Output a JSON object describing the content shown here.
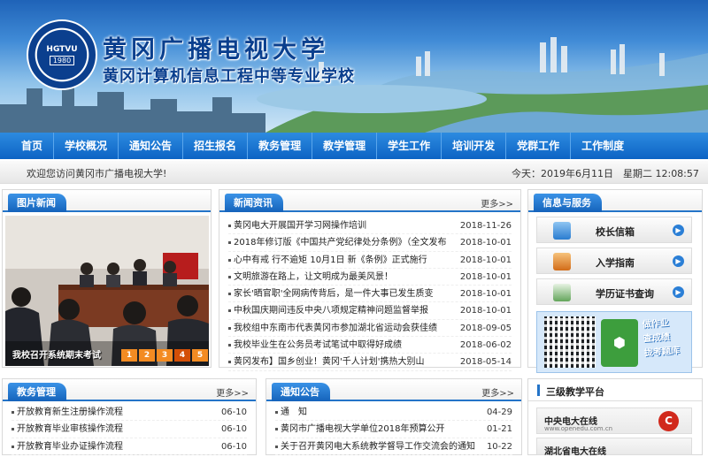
{
  "site": {
    "logo_text": "HGTVU",
    "logo_year": "1980",
    "title": "黄冈广播电视大学",
    "subtitle": "黄冈计算机信息工程中等专业学校"
  },
  "nav": [
    "首页",
    "学校概况",
    "通知公告",
    "招生报名",
    "教务管理",
    "教学管理",
    "学生工作",
    "培训开发",
    "党群工作",
    "工作制度"
  ],
  "welcome": {
    "text": "欢迎您访问黄冈市广播电视大学!",
    "date": "今天：2019年6月11日　星期二 12:08:57"
  },
  "photo_news": {
    "title": "图片新闻",
    "caption": "我校召开系统期末考试",
    "pages": [
      "1",
      "2",
      "3",
      "4",
      "5"
    ],
    "active_page": "4"
  },
  "news": {
    "title": "新闻资讯",
    "more": "更多>>",
    "items": [
      {
        "title": "黄冈电大开展国开学习网操作培训",
        "date": "2018-11-26"
      },
      {
        "title": "2018年修订版《中国共产党纪律处分条例》（全文发布",
        "date": "2018-10-01"
      },
      {
        "title": "心中有戒 行不逾矩 10月1日 新《条例》正式施行",
        "date": "2018-10-01"
      },
      {
        "title": "文明旅游在路上，让文明成为最美风景！",
        "date": "2018-10-01"
      },
      {
        "title": "家长'晒官职'全网病传背后，是一件大事已发生质变",
        "date": "2018-10-01"
      },
      {
        "title": "中秋国庆期间违反中央八项规定精神问题监督举报",
        "date": "2018-10-01"
      },
      {
        "title": "我校组中东南市代表黄冈市参加湖北省运动会获佳绩",
        "date": "2018-09-05"
      },
      {
        "title": "我校毕业生在公务员考试笔试中取得好成绩",
        "date": "2018-06-02"
      },
      {
        "title": "黄冈发布】国乡创业！黄冈'千人计划'携热大别山",
        "date": "2018-05-14"
      }
    ]
  },
  "services": {
    "title": "信息与服务",
    "items": [
      "校长信箱",
      "入学指南",
      "学历证书查询"
    ],
    "qr_text": [
      "做作业",
      "查成绩",
      "拢考题库"
    ]
  },
  "edu_admin": {
    "title": "教务管理",
    "more": "更多>>",
    "items": [
      {
        "title": "开放教育新生注册操作流程",
        "date": "06-10"
      },
      {
        "title": "开放教育毕业审核操作流程",
        "date": "06-10"
      },
      {
        "title": "开放教育毕业办证操作流程",
        "date": "06-10"
      }
    ]
  },
  "notices": {
    "title": "通知公告",
    "more": "更多>>",
    "items": [
      {
        "title": "通　知",
        "date": "04-29"
      },
      {
        "title": "黄冈市广播电视大学单位2018年预算公开",
        "date": "01-21"
      },
      {
        "title": "关于召开黄冈电大系统教学督导工作交流会的通知",
        "date": "10-22"
      }
    ]
  },
  "platforms": {
    "title": "三级教学平台",
    "items": [
      {
        "name": "中央电大在线",
        "url": "www.openedu.com.cn"
      },
      {
        "name": "湖北省电大在线",
        "url": ""
      }
    ]
  },
  "colors": {
    "primary": "#1563bb",
    "accent": "#f38b22",
    "nav": "#2d8be0"
  }
}
